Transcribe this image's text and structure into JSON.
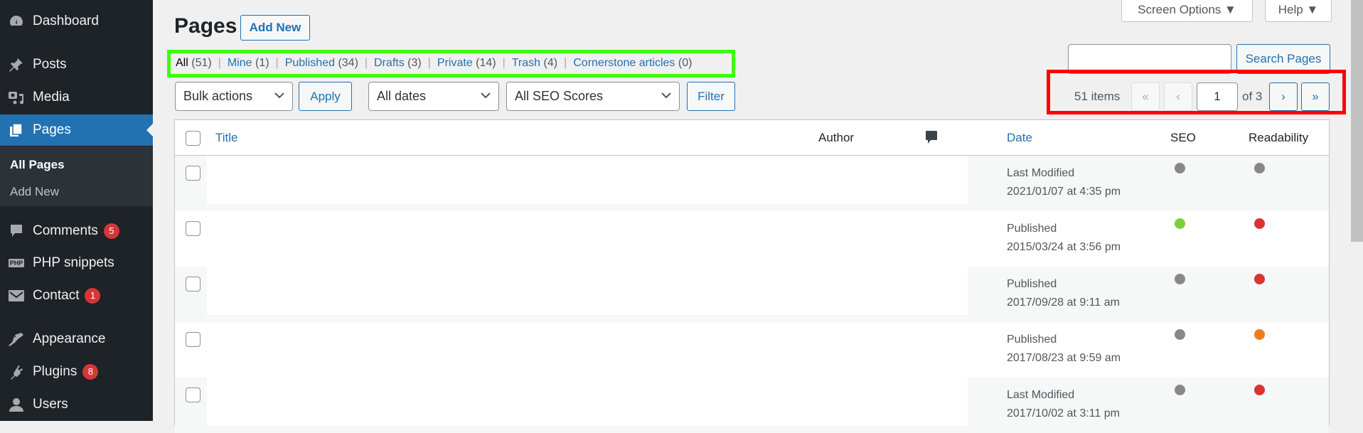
{
  "sidebar": {
    "items": [
      {
        "label": "Dashboard",
        "icon": "dashboard-icon"
      },
      {
        "label": "Posts",
        "icon": "pin-icon"
      },
      {
        "label": "Media",
        "icon": "media-icon"
      },
      {
        "label": "Pages",
        "icon": "pages-icon",
        "active": true
      },
      {
        "label": "Comments",
        "icon": "comment-icon",
        "badge": "5"
      },
      {
        "label": "PHP snippets",
        "icon": "php-icon"
      },
      {
        "label": "Contact",
        "icon": "mail-icon",
        "badge": "1"
      },
      {
        "label": "Appearance",
        "icon": "brush-icon"
      },
      {
        "label": "Plugins",
        "icon": "plugin-icon",
        "badge": "8"
      },
      {
        "label": "Users",
        "icon": "user-icon"
      }
    ],
    "submenu": [
      {
        "label": "All Pages",
        "current": true
      },
      {
        "label": "Add New"
      }
    ]
  },
  "header": {
    "title": "Pages",
    "add_new": "Add New",
    "screen_options": "Screen Options ▼",
    "help": "Help ▼"
  },
  "filters": {
    "views": [
      {
        "label": "All",
        "count": "(51)",
        "current": true
      },
      {
        "label": "Mine",
        "count": "(1)"
      },
      {
        "label": "Published",
        "count": "(34)"
      },
      {
        "label": "Drafts",
        "count": "(3)"
      },
      {
        "label": "Private",
        "count": "(14)"
      },
      {
        "label": "Trash",
        "count": "(4)"
      },
      {
        "label": "Cornerstone articles",
        "count": " (0)"
      }
    ],
    "bulk_actions": "Bulk actions",
    "apply": "Apply",
    "dates": "All dates",
    "seo_scores": "All SEO Scores",
    "filter": "Filter"
  },
  "search": {
    "value": "",
    "button": "Search Pages"
  },
  "pagination": {
    "items": "51 items",
    "first": "«",
    "prev": "‹",
    "current_page": "1",
    "of": "of 3",
    "next": "›",
    "last": "»"
  },
  "table": {
    "columns": {
      "title": "Title",
      "author": "Author",
      "comments_icon": "comment-bubble-icon",
      "date": "Date",
      "seo": "SEO",
      "readability": "Readability"
    },
    "colors": {
      "gray": "#888888",
      "green": "#7ad03a",
      "red": "#dc3232",
      "orange": "#ee7c1b"
    },
    "rows": [
      {
        "status": "Last Modified",
        "date": "2021/01/07 at 4:35 pm",
        "seo": "gray",
        "readability": "gray"
      },
      {
        "status": "Published",
        "date": "2015/03/24 at 3:56 pm",
        "seo": "green",
        "readability": "red"
      },
      {
        "status": "Published",
        "date": "2017/09/28 at 9:11 am",
        "seo": "gray",
        "readability": "red"
      },
      {
        "status": "Published",
        "date": "2017/08/23 at 9:59 am",
        "seo": "gray",
        "readability": "orange"
      },
      {
        "status": "Last Modified",
        "date": "2017/10/02 at 3:11 pm",
        "seo": "gray",
        "readability": "red"
      }
    ]
  }
}
